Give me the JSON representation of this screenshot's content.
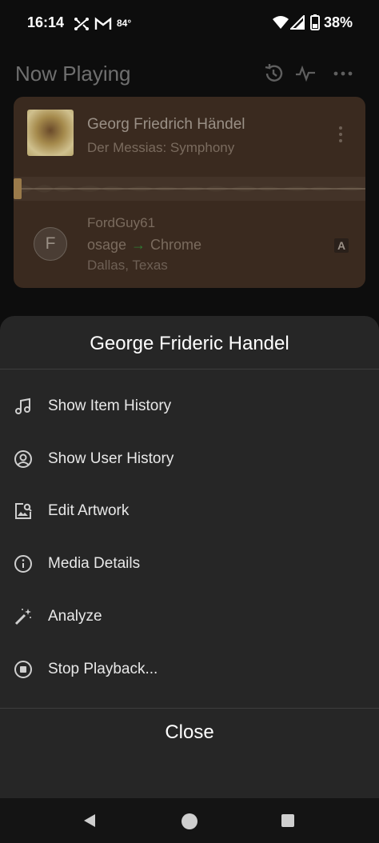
{
  "status_bar": {
    "time": "16:14",
    "temperature": "84°",
    "battery": "38%",
    "icons": [
      "shuffle-notification-icon",
      "gmail-icon",
      "wifi-icon",
      "signal-icon",
      "battery-icon"
    ]
  },
  "header": {
    "title": "Now Playing",
    "icons": [
      "history-icon",
      "activity-icon",
      "more-icon"
    ]
  },
  "now_playing_card": {
    "track_title": "Georg Friedrich Händel",
    "track_subtitle": "Der Messias: Symphony",
    "user_initial": "F",
    "user_name": "FordGuy61",
    "player_from": "osage",
    "player_arrow": "→",
    "player_to": "Chrome",
    "location": "Dallas, Texas",
    "quality_badge": "A"
  },
  "sheet": {
    "title": "George Frideric Handel",
    "items": [
      {
        "label": "Show Item History",
        "icon": "music-note-icon"
      },
      {
        "label": "Show User History",
        "icon": "user-circle-icon"
      },
      {
        "label": "Edit Artwork",
        "icon": "image-edit-icon"
      },
      {
        "label": "Media Details",
        "icon": "info-icon"
      },
      {
        "label": "Analyze",
        "icon": "magic-wand-icon"
      },
      {
        "label": "Stop Playback...",
        "icon": "stop-circle-icon"
      }
    ],
    "close_label": "Close"
  },
  "nav": {
    "buttons": [
      "back-icon",
      "home-icon",
      "recents-icon"
    ]
  },
  "colors": {
    "background": "#0d0d0d",
    "card": "#3a2a1f",
    "sheet": "#262626",
    "accent_arrow": "#2e7d32"
  }
}
